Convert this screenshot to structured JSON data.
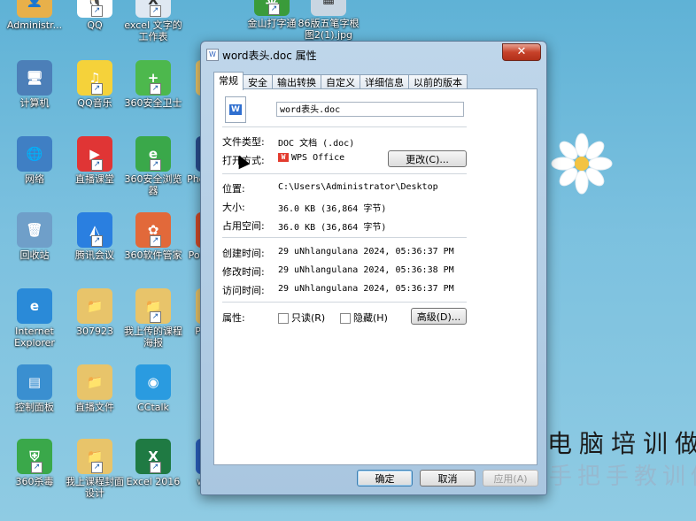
{
  "desktop": {
    "icons": [
      {
        "label": "Administr...",
        "color": "#e8b04a",
        "glyph": "👤",
        "shortcut": false
      },
      {
        "label": "QQ",
        "color": "#ffffff",
        "glyph": "🐧",
        "shortcut": true
      },
      {
        "label": "excel 文字的工作表",
        "color": "#dfe8f2",
        "glyph": "X",
        "shortcut": true
      },
      {
        "label": "金山打字通",
        "color": "#3a9b3a",
        "glyph": "金",
        "shortcut": true
      },
      {
        "label": "86版五笔字根图2(1).jpg",
        "color": "#c9d6e2",
        "glyph": "▦",
        "shortcut": false
      },
      {
        "label": "计算机",
        "color": "#4c7fb8",
        "glyph": "🖥",
        "shortcut": false
      },
      {
        "label": "QQ音乐",
        "color": "#f5d23a",
        "glyph": "♫",
        "shortcut": true
      },
      {
        "label": "360安全卫士",
        "color": "#4db84d",
        "glyph": "+",
        "shortcut": true
      },
      {
        "label": "ex...",
        "color": "#e8c46a",
        "glyph": "📁",
        "shortcut": true
      },
      {
        "label": "网络",
        "color": "#3f7fc4",
        "glyph": "🌐",
        "shortcut": false
      },
      {
        "label": "直播课堂",
        "color": "#e03535",
        "glyph": "▶",
        "shortcut": true
      },
      {
        "label": "360安全浏览器",
        "color": "#3aa84a",
        "glyph": "e",
        "shortcut": true
      },
      {
        "label": "Photo... CS",
        "color": "#2a4e8f",
        "glyph": "P",
        "shortcut": true
      },
      {
        "label": "回收站",
        "color": "#6f9fc9",
        "glyph": "🗑",
        "shortcut": false
      },
      {
        "label": "腾讯会议",
        "color": "#2a7fe0",
        "glyph": "◭",
        "shortcut": true
      },
      {
        "label": "360软件管家",
        "color": "#e2693a",
        "glyph": "✿",
        "shortcut": true
      },
      {
        "label": "Powe... 20",
        "color": "#d04a2a",
        "glyph": "P",
        "shortcut": true
      },
      {
        "label": "Internet Explorer",
        "color": "#2a8ad8",
        "glyph": "e",
        "shortcut": false
      },
      {
        "label": "307923",
        "color": "#e8c46a",
        "glyph": "📁",
        "shortcut": false
      },
      {
        "label": "我上传的课程海报",
        "color": "#e8c46a",
        "glyph": "📁",
        "shortcut": true
      },
      {
        "label": "PPT素...",
        "color": "#e8c46a",
        "glyph": "📁",
        "shortcut": true
      },
      {
        "label": "控制面板",
        "color": "#3a8fd0",
        "glyph": "▤",
        "shortcut": false
      },
      {
        "label": "直播文件",
        "color": "#e8c46a",
        "glyph": "📁",
        "shortcut": false
      },
      {
        "label": "CCtalk",
        "color": "#2a9be0",
        "glyph": "◉",
        "shortcut": false
      },
      {
        "label": "360杀毒",
        "color": "#3aa84a",
        "glyph": "⛨",
        "shortcut": true
      },
      {
        "label": "我上课程封面设计",
        "color": "#e8c46a",
        "glyph": "📁",
        "shortcut": true
      },
      {
        "label": "Excel 2016",
        "color": "#1f7a43",
        "glyph": "X",
        "shortcut": true
      },
      {
        "label": "word...",
        "color": "#2a5fbd",
        "glyph": "W",
        "shortcut": true
      }
    ],
    "watermark_line1": "电脑培训做",
    "watermark_line2": "手把手教训做"
  },
  "dialog": {
    "title": "word表头.doc 属性",
    "close_glyph": "✕",
    "tabs": [
      "常规",
      "安全",
      "输出转换",
      "自定义",
      "详细信息",
      "以前的版本"
    ],
    "active_tab": 0,
    "file_name": "word表头.doc",
    "file_type_label": "文件类型:",
    "file_type_value": "DOC 文档 (.doc)",
    "open_with_label": "打开方式:",
    "open_with_value": "WPS Office",
    "open_with_logo": "W",
    "change_button": "更改(C)...",
    "location_label": "位置:",
    "location_value": "C:\\Users\\Administrator\\Desktop",
    "size_label": "大小:",
    "size_value": "36.0 KB (36,864 字节)",
    "size_on_disk_label": "占用空间:",
    "size_on_disk_value": "36.0 KB (36,864 字节)",
    "created_label": "创建时间:",
    "created_value": "29 uNhlangulana 2024, 05:36:37 PM",
    "modified_label": "修改时间:",
    "modified_value": "29 uNhlangulana 2024, 05:36:38 PM",
    "accessed_label": "访问时间:",
    "accessed_value": "29 uNhlangulana 2024, 05:36:37 PM",
    "attributes_label": "属性:",
    "readonly_label": "只读(R)",
    "hidden_label": "隐藏(H)",
    "advanced_button": "高级(D)...",
    "ok_button": "确定",
    "cancel_button": "取消",
    "apply_button": "应用(A)"
  }
}
